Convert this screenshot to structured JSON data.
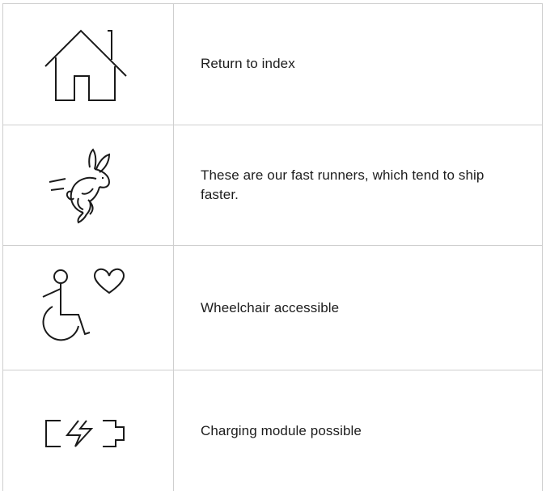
{
  "legend": {
    "rows": [
      {
        "icon": "house-icon",
        "text": "Return to index"
      },
      {
        "icon": "rabbit-icon",
        "text": "These are our fast runners, which tend to ship faster."
      },
      {
        "icon": "wheelchair-heart-icon",
        "text": "Wheelchair accessible"
      },
      {
        "icon": "battery-charging-icon",
        "text": "Charging module possible"
      }
    ]
  },
  "colors": {
    "border": "#cfcfcf",
    "text": "#1d1d1d",
    "icon_stroke": "#1a1a1a",
    "background": "#ffffff"
  }
}
